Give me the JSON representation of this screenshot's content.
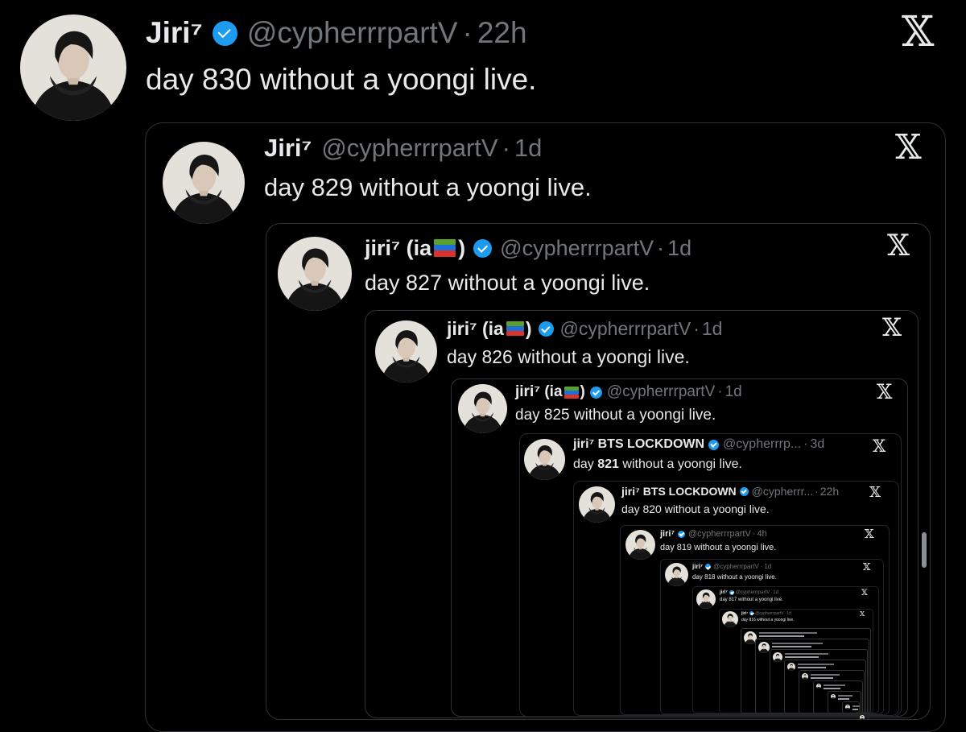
{
  "tweet": {
    "name": "Jiri⁷",
    "handle": "@cypherrrpartV",
    "sep": "·",
    "time": "22h",
    "text": "day 830 without a yoongi live."
  },
  "quotes": [
    {
      "name": "Jiri⁷",
      "handle": "@cypherrrpartV",
      "sep": "·",
      "time": "1d",
      "text": "day 829 without a yoongi live."
    },
    {
      "name": "jiri⁷ (ia",
      "name_close": ")",
      "handle": "@cypherrrpartV",
      "sep": "·",
      "time": "1d",
      "text": "day 827 without a yoongi live."
    },
    {
      "name": "jiri⁷ (ia",
      "name_close": ")",
      "handle": "@cypherrrpartV",
      "sep": "·",
      "time": "1d",
      "text": "day 826 without a yoongi live."
    },
    {
      "name": "jiri⁷ (ia",
      "name_close": ")",
      "handle": "@cypherrrpartV",
      "sep": "·",
      "time": "1d",
      "text": "day 825 without a yoongi live."
    },
    {
      "name": "jiri⁷ BTS LOCKDOWN",
      "handle": "@cypherrrp...",
      "sep": "·",
      "time": "3d",
      "text_pre": "day ",
      "text_bold": "821",
      "text_post": " without a yoongi live."
    },
    {
      "name": "jiri⁷ BTS LOCKDOWN",
      "handle": "@cypherrr...",
      "sep": "·",
      "time": "22h",
      "text": "day 820 without a yoongi live."
    },
    {
      "name": "jiri⁷",
      "handle": "@cypherrrpartV",
      "sep": "·",
      "time": "4h",
      "text": "day 819 without a yoongi live."
    },
    {
      "name": "jiri⁷",
      "handle": "@cypherrrpartV",
      "sep": "·",
      "time": "1d",
      "text": "day 818 without a yoongi live."
    },
    {
      "name": "jiri⁷",
      "handle": "@cypherrrpartV",
      "sep": "·",
      "time": "1d",
      "text": "day 817 without a yoongi live."
    },
    {
      "name": "jiri⁷",
      "handle": "@cypherrrpartV",
      "sep": "·",
      "time": "1d",
      "text": "day 816 without a yoongi live."
    }
  ],
  "x_logo": "𝕏",
  "icons": {
    "verified": "verified-badge-icon",
    "books": "books-emoji-icon",
    "close": "x-logo-icon"
  },
  "colors": {
    "background": "#000000",
    "text": "#e7e9ea",
    "muted": "#71767b",
    "border": "#2f3336",
    "verified": "#1d9bf0"
  }
}
